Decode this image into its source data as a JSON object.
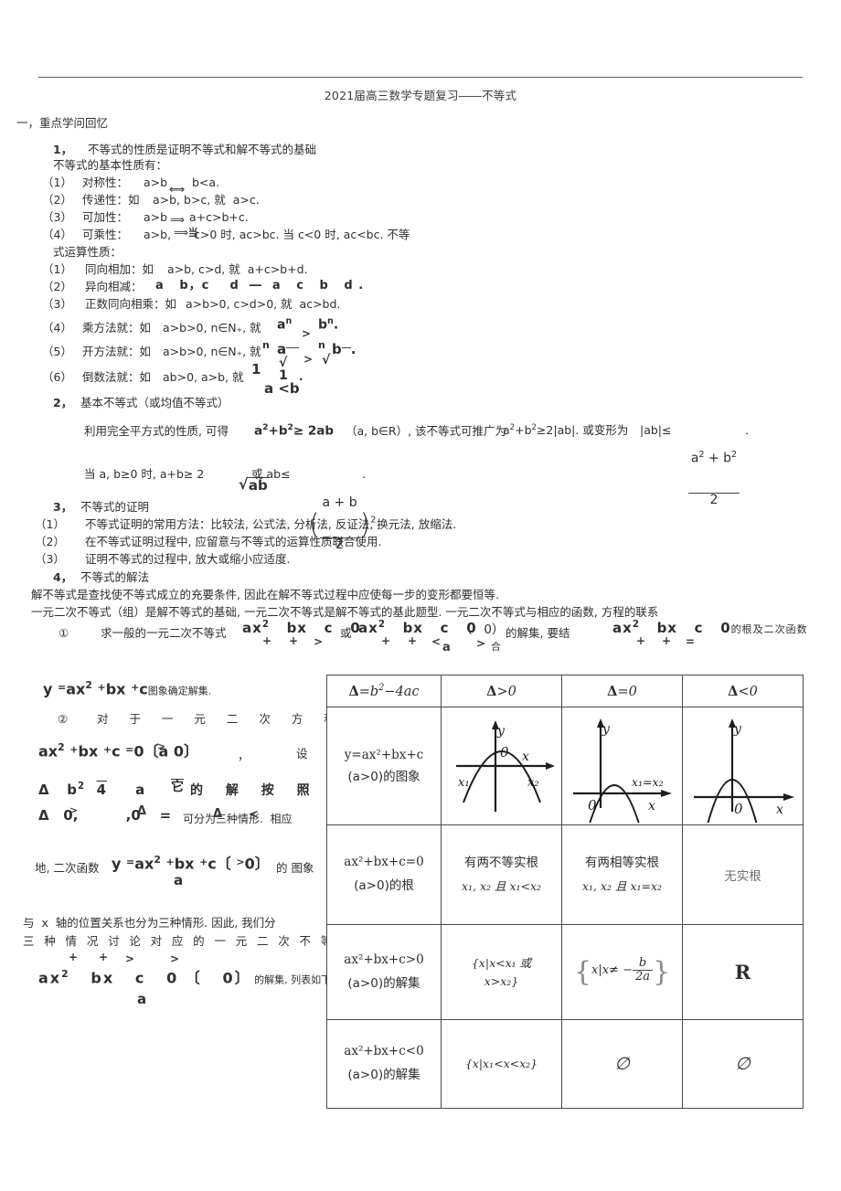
{
  "header": {
    "title": "2021届高三数学专题复习――不等式"
  },
  "section_title": "一，重点学问回忆",
  "s1": {
    "num": "1，",
    "heading": "不等式的性质是证明不等式和解不等式的基础",
    "subheading": "不等式的基本性质有：",
    "items": [
      {
        "no": "（1）",
        "label": "对称性：",
        "body": "a>b",
        "tail": "b<a.",
        "op": "⟺"
      },
      {
        "no": "（2）",
        "label": "传递性：如",
        "body": "a>b, b>c, 就  a>c.",
        "tail": "",
        "op": ""
      },
      {
        "no": "（3）",
        "label": "可加性：",
        "body": "a>b",
        "tail": "a+c>b+c.",
        "op": "⟹"
      },
      {
        "no": "（4）",
        "label": "可乘性：",
        "body": "a>b,",
        "tail": "c>0 时, ac>bc. 当 c<0 时, ac<bc. 不等",
        "op": "⟹当"
      }
    ],
    "ops_heading": "式运算性质：",
    "ops": [
      {
        "no": "（1）",
        "label": "同向相加：如",
        "body": "a>b, c>d, 就  a+c>b+d."
      },
      {
        "no": "（2）",
        "label": "异向相减：",
        "body": "a   b，c    d  ―  a   c   b   d ."
      },
      {
        "no": "（3）",
        "label": "正数同向相乘：如",
        "body": "a>b>0, c>d>0, 就  ac>bd."
      },
      {
        "no": "（4）",
        "label": "乘方法就：如",
        "body": "a>b>0, n∈N₊, 就",
        "extra": "aⁿ > bⁿ."
      },
      {
        "no": "（5）",
        "label": "开方法就：如",
        "body": "a>b>0, n∈N₊, 就",
        "extra": "ⁿ√a > ⁿ√b."
      },
      {
        "no": "（6）",
        "label": "倒数法就：如",
        "body": "ab>0, a>b, 就",
        "extra": "1/a < 1/b."
      }
    ]
  },
  "s2": {
    "num": "2，",
    "heading": "基本不等式（或均值不等式）",
    "line1_pre": "利用完全平方式的性质, 可得",
    "line1_f1": "a²+b²≥2ab",
    "line1_mid": "（a, b∈R）, 该不等式可推广为",
    "line1_f2": "a²+b²≥2|ab|. 或变形为",
    "line1_f3_pre": "|ab|≤",
    "line1_f3_num": "a² + b²",
    "line1_f3_den": "2",
    "line1_end": ".",
    "line2_pre": "当 a, b≥0 时, a+b≥ 2",
    "line2_rad": "ab",
    "line2_mid": "或 ab≤",
    "line2_num": "a + b",
    "line2_den": "2",
    "line2_exp": "2",
    "line2_end": "."
  },
  "s3": {
    "num": "3，",
    "heading": "不等式的证明",
    "items": [
      {
        "no": "（1）",
        "body": "不等式证明的常用方法：比较法, 公式法, 分析法, 反证法, 换元法, 放缩法."
      },
      {
        "no": "（2）",
        "body": "在不等式证明过程中, 应留意与不等式的运算性质联合使用."
      },
      {
        "no": "（3）",
        "body": "证明不等式的过程中, 放大或缩小应适度."
      }
    ]
  },
  "s4": {
    "num": "4，",
    "heading": "不等式的解法",
    "p1": "解不等式是查找使不等式成立的充要条件, 因此在解不等式过程中应使每一步的变形都要恒等.",
    "p2": "一元二次不等式（组）是解不等式的基础, 一元二次不等式是解不等式的基此题型. 一元二次不等式与相应的函数, 方程的联系",
    "item1": {
      "mark": "①",
      "lead": "求一般的一元二次不等式",
      "f1": "ax²  bx  c   0",
      "or": "或",
      "f2": "ax²  bx  c   0",
      "paren": "（   0）",
      "mid": "的解集, 要结",
      "f3": "ax²  bx  c   0的根及二次函数",
      "frag_plus1": "+",
      "frag_plus2": "+",
      "frag_gt": ">",
      "frag_a": "a",
      "frag_he": "合",
      "frag_eq": "="
    },
    "line_y": "y = ax² + bx + c 图象确定解集.",
    "item2": {
      "mark": "②",
      "lead": "对 于 一 元 二 次 方 程",
      "eq": "ax² + bx + c = 0（a  0）",
      "comma": "，",
      "she": "设",
      "delta1": "Δ   b²   4     a",
      "ta": "它",
      "de": "的   解   按   照",
      "delta2": "Δ    0,          ,0    =",
      "fenwei": "可分为三种情形.  相应",
      "di": "地, 二次函数",
      "fn": "y = ax² + bx + c（  > 0）",
      "detuxiang": "的 图象",
      "fn_a": "a",
      "xline": "与  x  轴的位置关系也分为三种情形. 因此, 我们分",
      "xline2": "三 种 情 况 讨 论 对 应 的 一 元 二 次 不 等 式",
      "f4": "ax²   bx   c    0 （    0）",
      "f4_a": "a",
      "f4_tail": "的解集, 列表如下：",
      "frag_plus1": "+",
      "frag_plus2": "+",
      "frag_gt1": ">",
      "frag_gt2": ">"
    }
  },
  "table": {
    "headers": [
      "Δ=b²−4ac",
      "Δ>0",
      "Δ=0",
      "Δ<0"
    ],
    "rows": [
      {
        "label": "y=ax²+bx+c\n(a>0)的图象",
        "label_l1": "y=ax²+bx+c",
        "label_l2": "(a>0)的图象",
        "type": "graph",
        "cells": [
          "parabola-two-roots",
          "parabola-double-root",
          "parabola-no-root"
        ],
        "graph_labels": {
          "c1": {
            "y": "y",
            "x": "x",
            "origin": "0",
            "x1": "x₁",
            "x2": "x₂"
          },
          "c2": {
            "y": "y",
            "x": "x",
            "origin": "0",
            "roots": "x₁=x₂"
          },
          "c3": {
            "y": "y",
            "x": "x",
            "origin": "0"
          }
        }
      },
      {
        "label_l1": "ax²+bx+c=0",
        "label_l2": "(a>0)的根",
        "type": "text",
        "cells": [
          {
            "l1": "有两不等实根",
            "l2": "x₁, x₂ 且 x₁<x₂"
          },
          {
            "l1": "有两相等实根",
            "l2": "x₁, x₂ 且 x₁=x₂"
          },
          {
            "l1": "无实根",
            "l2": ""
          }
        ]
      },
      {
        "label_l1": "ax²+bx+c>0",
        "label_l2": "(a>0)的解集",
        "type": "text",
        "cells": [
          {
            "l1": "{x|x<x₁ 或",
            "l2": "x>x₂}"
          },
          {
            "l1": "{x|x≠ − b/2a}",
            "l2": ""
          },
          {
            "l1": "R",
            "l2": ""
          }
        ]
      },
      {
        "label_l1": "ax²+bx+c<0",
        "label_l2": "(a>0)的解集",
        "type": "text",
        "cells": [
          {
            "l1": "{x|x₁<x<x₂}",
            "l2": ""
          },
          {
            "l1": "∅",
            "l2": ""
          },
          {
            "l1": "∅",
            "l2": ""
          }
        ]
      }
    ]
  }
}
